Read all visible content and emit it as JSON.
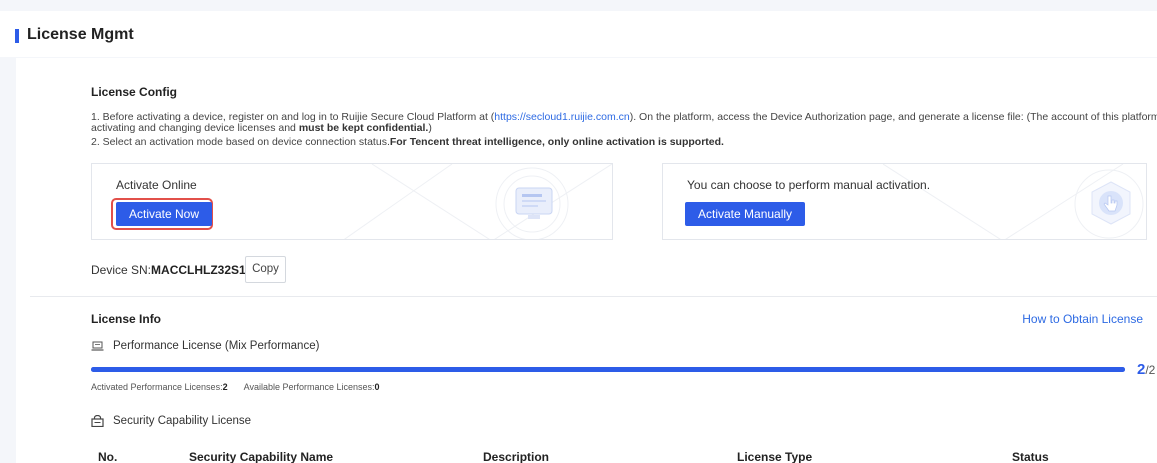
{
  "header": {
    "title": "License Mgmt"
  },
  "license_config": {
    "title": "License Config",
    "line1_prefix": "1. Before activating a device, register on and log in to Ruijie Secure Cloud Platform at (",
    "line1_link": "https://secloud1.ruijie.com.cn",
    "line1_suffix": "). On the platform, access the Device Authorization page, and generate a license file: (The account of this platform is used for",
    "line1b_prefix": "activating and changing device licenses and ",
    "line1b_bold": "must be kept confidential.",
    "line1b_suffix": ")",
    "line2_prefix": "2. Select an activation mode based on device connection status.",
    "line2_bold": "For Tencent threat intelligence, only online activation is supported."
  },
  "online_card": {
    "label": "Activate Online",
    "button": "Activate Now",
    "icon": "monitor-icon"
  },
  "manual_card": {
    "label": "You can choose to perform manual activation.",
    "button": "Activate Manually",
    "icon": "hand-pointer-icon"
  },
  "device": {
    "sn_label": "Device SN:",
    "sn_value": "MACCLHLZ32S12",
    "copy_label": "Copy"
  },
  "license_info": {
    "title": "License Info",
    "how_link": "How to Obtain License",
    "performance": {
      "label": "Performance License (Mix Performance)",
      "used": "2",
      "total": "/2",
      "fraction": 1.0,
      "activated_label": "Activated Performance Licenses:",
      "activated_value": "2",
      "available_label": "Available Performance Licenses:",
      "available_value": "0"
    },
    "security": {
      "label": "Security Capability License",
      "columns": [
        "No.",
        "Security Capability Name",
        "Description",
        "License Type",
        "Status"
      ]
    }
  },
  "colors": {
    "accent": "#2d5ce8",
    "highlight": "#e2504a",
    "link": "#2d6ae3"
  }
}
